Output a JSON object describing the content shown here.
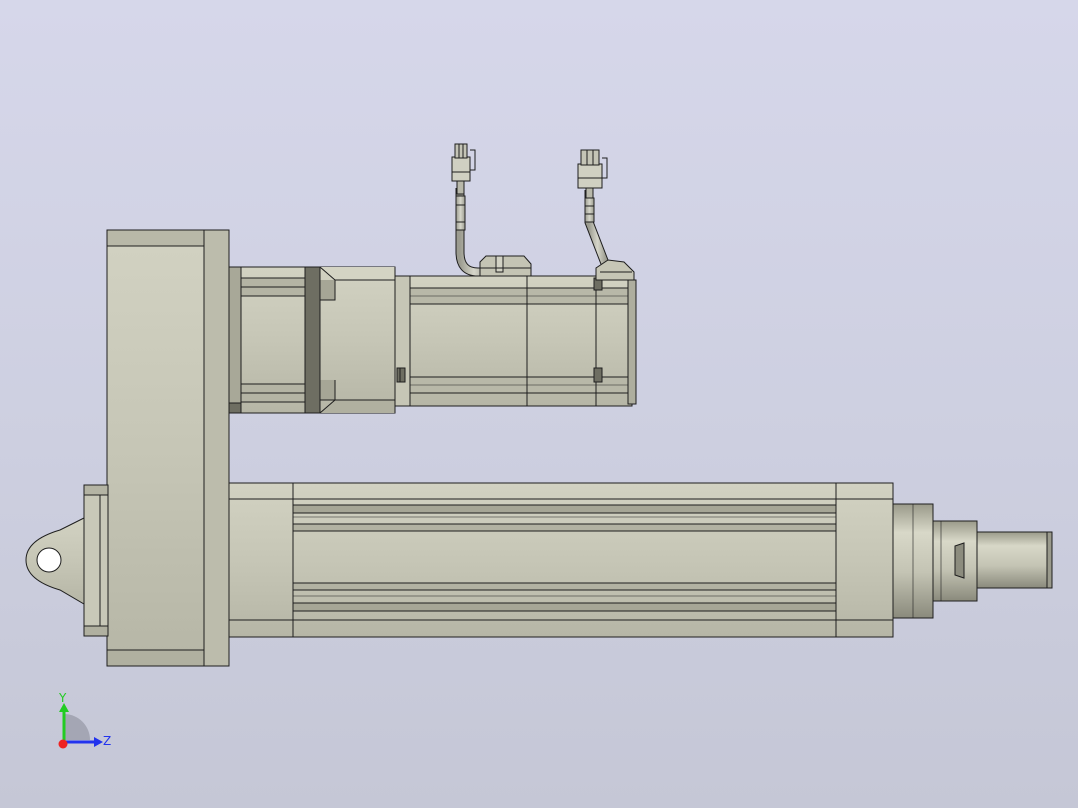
{
  "viewport": {
    "background_top": "#d6d7ea",
    "background_bottom": "#c5c7d6"
  },
  "model": {
    "body_color": "#c8c8b8",
    "shade_color": "#a8a898",
    "dark_color": "#6e6e62",
    "edge_color": "#1e1e1e"
  },
  "triad": {
    "y_label": "Y",
    "z_label": "Z",
    "y_color": "#22cc22",
    "z_color": "#2233ee",
    "x_color": "#ee2222"
  }
}
